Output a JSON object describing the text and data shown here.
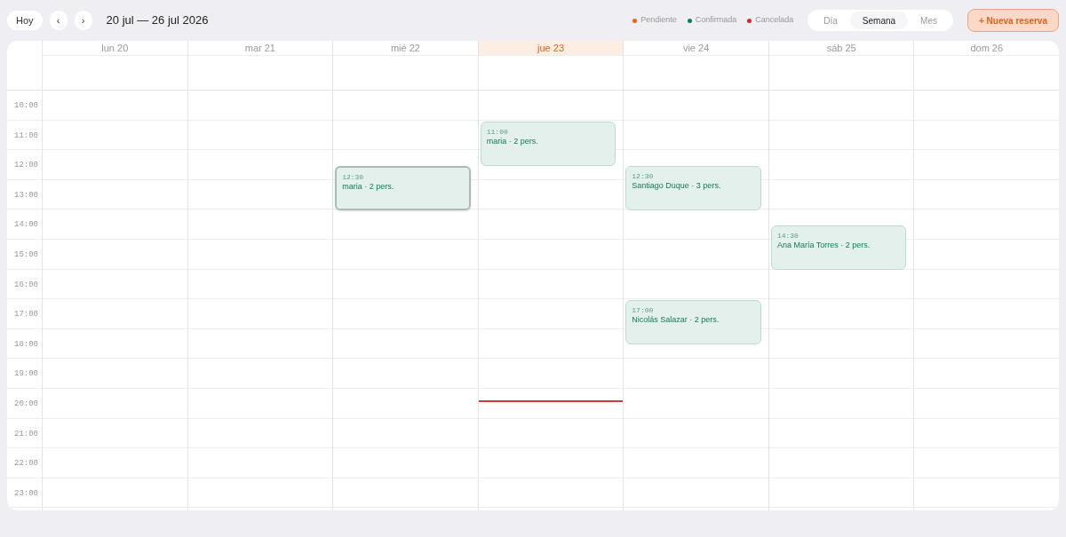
{
  "toolbar": {
    "today_button": "Hoy",
    "prev_button": "‹",
    "next_button": "›",
    "range_title": "20 jul — 26 jul 2026"
  },
  "legend": [
    {
      "label": "Pendiente",
      "color": "#e8641c"
    },
    {
      "label": "Confirmada",
      "color": "#137a55"
    },
    {
      "label": "Cancelada",
      "color": "#d42a2a"
    }
  ],
  "views": [
    {
      "label": "Día",
      "selected": false
    },
    {
      "label": "Semana",
      "selected": true
    },
    {
      "label": "Mes",
      "selected": false
    }
  ],
  "new_button": "+ Nueva reserva",
  "days": [
    {
      "label": "lun 20",
      "today": false
    },
    {
      "label": "mar 21",
      "today": false
    },
    {
      "label": "mié 22",
      "today": false,
      "events": [
        {
          "time": "12:30",
          "title": "maria · 2 pers.",
          "selected": true
        }
      ]
    },
    {
      "label": "jue 23",
      "today": true,
      "events": [
        {
          "time": "11:00",
          "title": "maria · 2 pers.",
          "selected": false
        }
      ]
    },
    {
      "label": "vie 24",
      "today": false,
      "events": [
        {
          "time": "12:30",
          "title": "Santiago Duque · 3 pers.",
          "selected": false
        },
        {
          "time": "17:00",
          "title": "Nicolás Salazar · 2 pers.",
          "selected": false
        }
      ]
    },
    {
      "label": "sáb 25",
      "today": false,
      "events": [
        {
          "time": "14:30",
          "title": "Ana María Torres · 2 pers.",
          "selected": false
        }
      ]
    },
    {
      "label": "dom 26",
      "today": false
    }
  ],
  "hours": [
    "10:00",
    "11:00",
    "12:00",
    "13:00",
    "14:00",
    "15:00",
    "16:00",
    "17:00",
    "18:00",
    "19:00",
    "20:00",
    "21:00",
    "22:00",
    "23:00"
  ]
}
